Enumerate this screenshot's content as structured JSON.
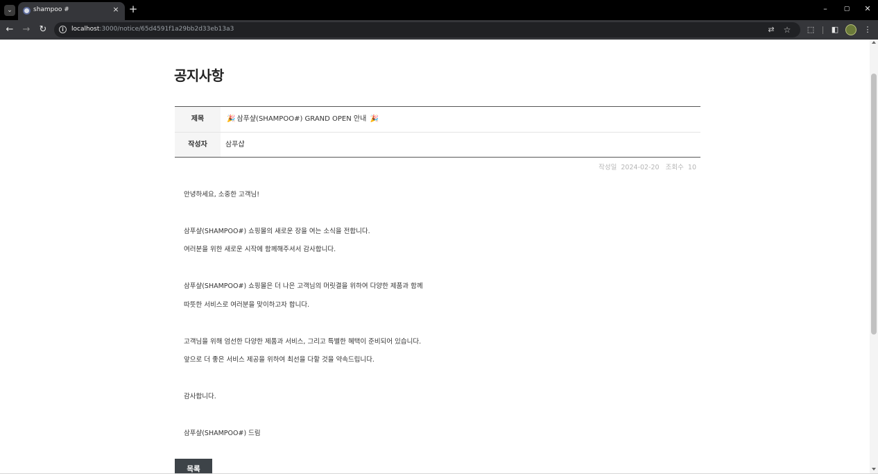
{
  "browser": {
    "tab_title": "shampoo #",
    "close_tab_glyph": "×",
    "new_tab_glyph": "+",
    "url_host": "localhost",
    "url_path": ":3000/notice/65d4591f1a29bb2d33eb13a3",
    "window_controls": [
      "–",
      "▢",
      "✕"
    ],
    "icons": [
      "tab-search-icon",
      "shampoo-favicon",
      "back-arrow-icon",
      "forward-arrow-icon",
      "reload-icon",
      "site-info-icon",
      "translate-icon",
      "bookmark-star-icon",
      "extensions-icon",
      "side-panel-icon",
      "profile-avatar",
      "more-menu-icon"
    ]
  },
  "notice": {
    "page_title": "공지사항",
    "title_label": "제목",
    "title_value": "삼푸샾(SHAMPOO#) GRAND OPEN 안내",
    "title_emoji": "🎉",
    "author_label": "작성자",
    "author_value": "삼푸샵",
    "date_label": "작성일",
    "date_value": "2024-02-20",
    "views_label": "조회수",
    "views_value": "10",
    "body": [
      "안녕하세요, 소중한 고객님!",
      "삼푸샾(SHAMPOO#) 쇼핑몰의 새로운 장을 여는 소식을 전합니다.",
      "여러분을 위한 새로운 시작에 함께해주셔서 감사합니다.",
      "삼푸샾(SHAMPOO#) 쇼핑몰은 더 나은 고객님의 머릿결을 위하여 다양한 제품과 함께",
      "따뜻한 서비스로 여러분을 맞이하고자 합니다.",
      "고객님을 위해 엄선한 다양한 제품과 서비스, 그리고 특별한 혜택이 준비되어 있습니다.",
      "앞으로 더 좋은 서비스 제공을 위하여 최선을 다할 것을 약속드립니다.",
      "감사합니다.",
      "삼푸샾(SHAMPOO#) 드림"
    ],
    "list_button": "목록"
  },
  "colors": {
    "browser_frame": "#000000",
    "toolbar": "#35363a",
    "button_bg": "#3d4348",
    "meta_text": "#b5b5b5"
  }
}
